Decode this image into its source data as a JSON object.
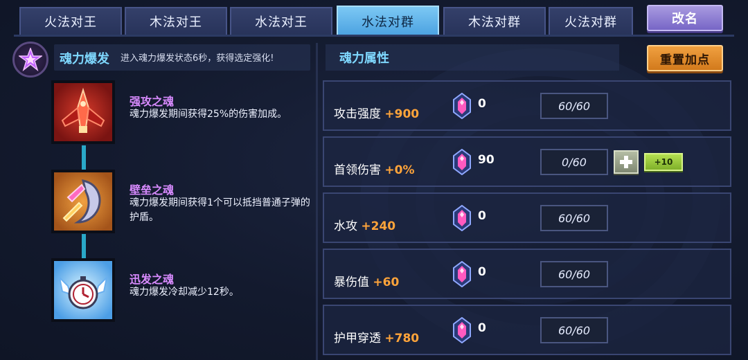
{
  "tabs": [
    {
      "label": "火法对王",
      "active": false
    },
    {
      "label": "木法对王",
      "active": false
    },
    {
      "label": "水法对王",
      "active": false
    },
    {
      "label": "水法对群",
      "active": true
    },
    {
      "label": "木法对群",
      "active": false
    },
    {
      "label": "火法对群",
      "active": false
    }
  ],
  "rename_label": "改名",
  "burst": {
    "title": "魂力爆发",
    "description": "进入魂力爆发状态6秒，获得选定强化!"
  },
  "skills": [
    {
      "name": "强攻之魂",
      "description": "魂力爆发期间获得25%的伤害加成。",
      "icon": "red-winged-ship-icon"
    },
    {
      "name": "壁垒之魂",
      "description": "魂力爆发期间获得1个可以抵挡普通子弹的护盾。",
      "icon": "shield-crescent-icon"
    },
    {
      "name": "迅发之魂",
      "description": "魂力爆发冷却减少12秒。",
      "icon": "winged-clock-icon"
    }
  ],
  "attributes_header": "魂力属性",
  "reset_label": "重置加点",
  "attributes": [
    {
      "name": "攻击强度",
      "bonus": "+900",
      "gems": "0",
      "level": "60/60"
    },
    {
      "name": "首领伤害",
      "bonus": "+0%",
      "gems": "90",
      "level": "0/60",
      "plus_label": "+",
      "plus10_label": "+10"
    },
    {
      "name": "水攻",
      "bonus": "+240",
      "gems": "0",
      "level": "60/60"
    },
    {
      "name": "暴伤值",
      "bonus": "+60",
      "gems": "0",
      "level": "60/60"
    },
    {
      "name": "护甲穿透",
      "bonus": "+780",
      "gems": "0",
      "level": "60/60"
    }
  ],
  "colors": {
    "accent_cyan": "#7fd8ff",
    "bonus_orange": "#ffa43a",
    "skill_name_purple": "#d98bff",
    "active_tab": "#4aa1e0"
  }
}
